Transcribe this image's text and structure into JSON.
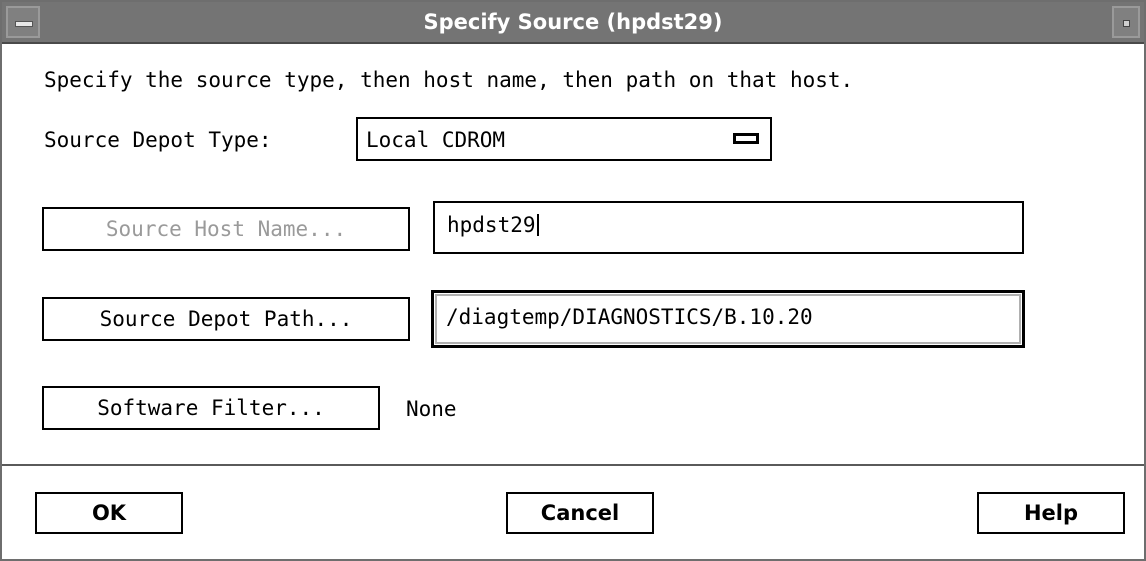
{
  "window": {
    "title": "Specify Source (hpdst29)"
  },
  "instructions": "Specify the source type, then host name, then path on that host.",
  "source_depot_type": {
    "label": "Source Depot Type:",
    "value": "Local CDROM"
  },
  "source_host": {
    "button_label": "Source Host Name...",
    "value": "hpdst29",
    "button_enabled": false
  },
  "source_path": {
    "button_label": "Source Depot Path...",
    "value": "/diagtemp/DIAGNOSTICS/B.10.20"
  },
  "software_filter": {
    "button_label": "Software Filter...",
    "value": "None"
  },
  "actions": {
    "ok": "OK",
    "cancel": "Cancel",
    "help": "Help"
  },
  "icons": {
    "window_menu": "window-menu-icon",
    "minimize": "minimize-icon",
    "option_indicator": "option-menu-indicator-icon"
  }
}
